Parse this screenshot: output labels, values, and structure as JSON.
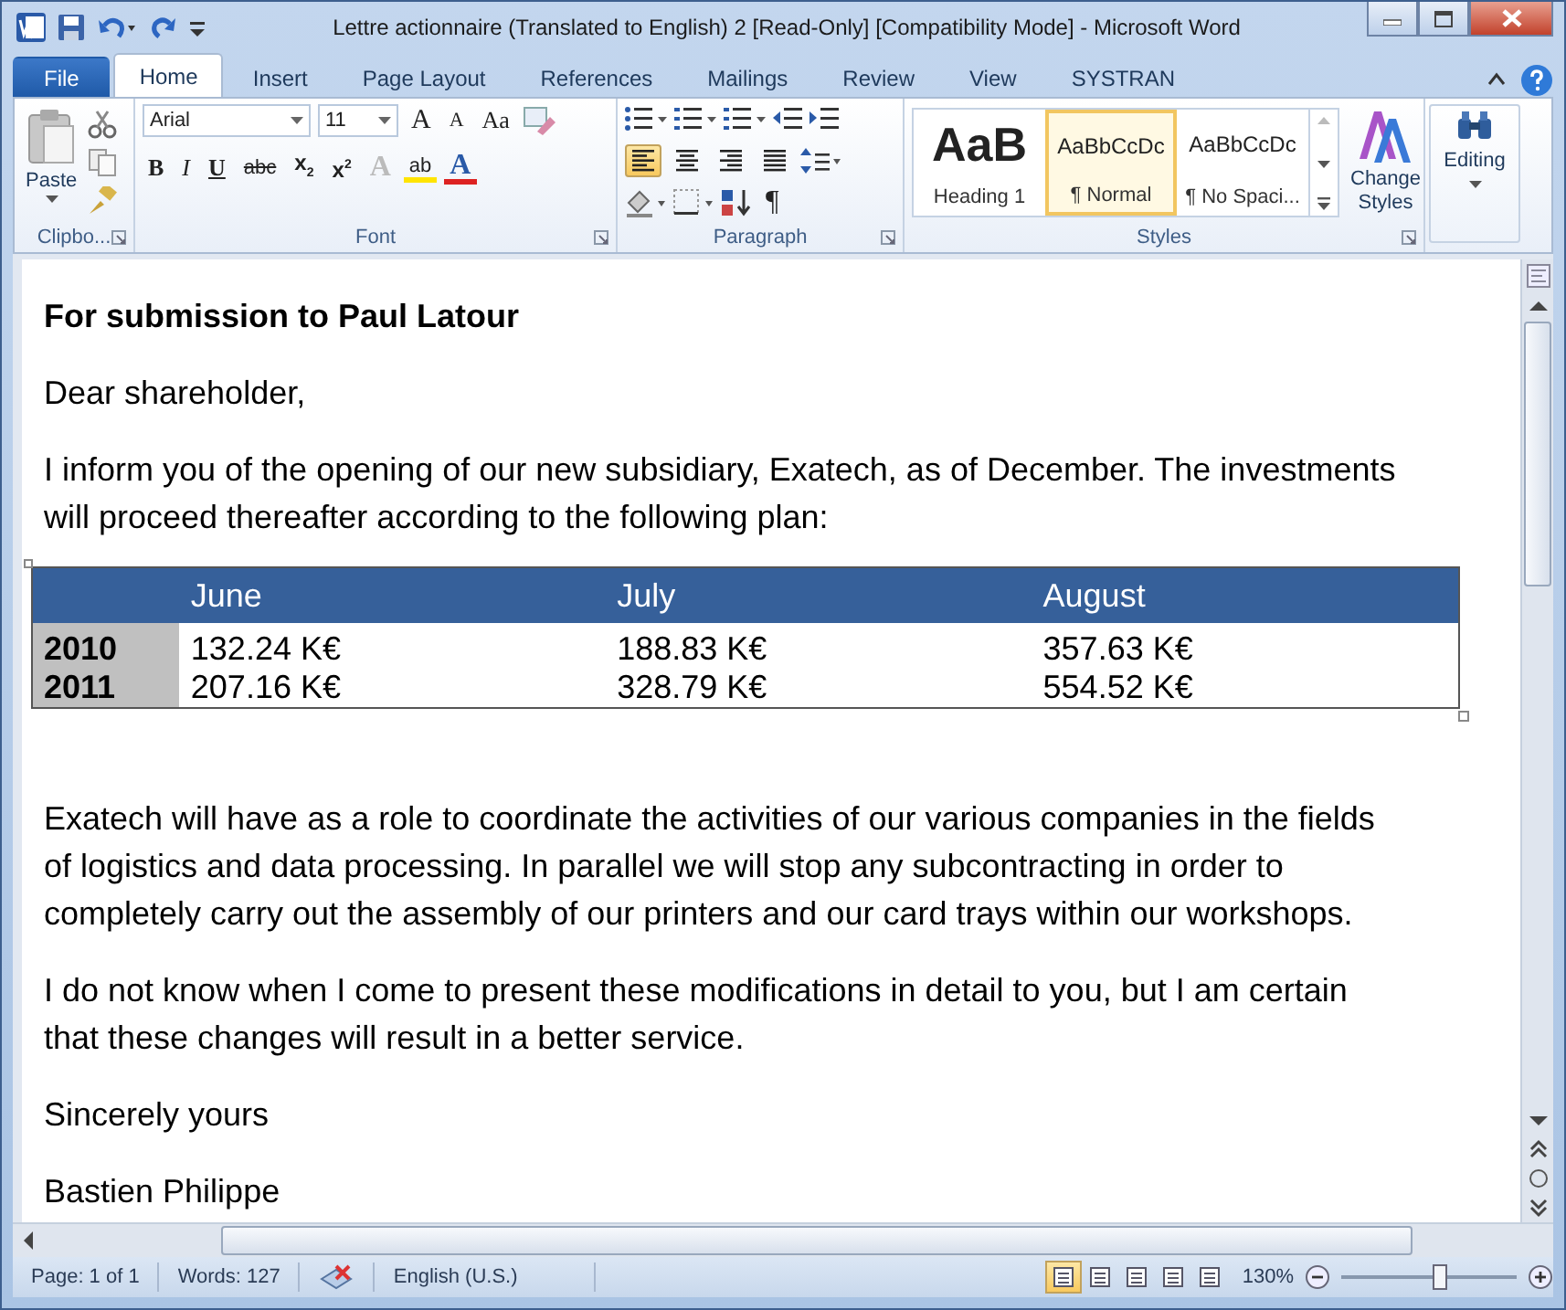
{
  "window": {
    "title": "Lettre actionnaire (Translated to English) 2 [Read-Only] [Compatibility Mode]  -  Microsoft Word"
  },
  "tabs": [
    {
      "label": "File",
      "kind": "file",
      "selected": false
    },
    {
      "label": "Home",
      "kind": "tab",
      "selected": true
    },
    {
      "label": "Insert",
      "kind": "tab",
      "selected": false
    },
    {
      "label": "Page Layout",
      "kind": "tab",
      "selected": false
    },
    {
      "label": "References",
      "kind": "tab",
      "selected": false
    },
    {
      "label": "Mailings",
      "kind": "tab",
      "selected": false
    },
    {
      "label": "Review",
      "kind": "tab",
      "selected": false
    },
    {
      "label": "View",
      "kind": "tab",
      "selected": false
    },
    {
      "label": "SYSTRAN",
      "kind": "tab",
      "selected": false
    }
  ],
  "ribbon": {
    "clipboard": {
      "paste": "Paste",
      "label": "Clipbo..."
    },
    "font": {
      "name": "Arial",
      "size": "11",
      "label": "Font",
      "row1": [
        {
          "kind": "grow",
          "glyph": "A"
        },
        {
          "kind": "shrink",
          "glyph": "A"
        },
        {
          "kind": "case",
          "glyph": "Aa"
        }
      ],
      "row2": [
        {
          "kind": "bold",
          "glyph": "B"
        },
        {
          "kind": "italic",
          "glyph": "I"
        },
        {
          "kind": "underline",
          "glyph": "U"
        },
        {
          "kind": "strike",
          "glyph": "abc"
        },
        {
          "kind": "sub",
          "glyph": "x$_{2}$"
        },
        {
          "kind": "sup",
          "glyph": "x$^{2}$"
        },
        {
          "kind": "effects",
          "glyph": "A"
        },
        {
          "kind": "highlight",
          "glyph": "ab"
        },
        {
          "kind": "color",
          "glyph": "A"
        }
      ]
    },
    "paragraph": {
      "label": "Paragraph",
      "show_marks": "¶",
      "align": [
        {
          "selected": true
        },
        {
          "selected": false
        },
        {
          "selected": false
        },
        {
          "selected": false
        }
      ]
    },
    "styles": {
      "label": "Styles",
      "items": [
        {
          "preview": "AaB",
          "name": "Heading 1",
          "kind": "heading",
          "selected": false
        },
        {
          "preview": "AaBbCcDc",
          "name": "¶ Normal",
          "kind": "normal",
          "selected": true
        },
        {
          "preview": "AaBbCcDc",
          "name": "¶ No Spaci...",
          "kind": "normal",
          "selected": false
        }
      ],
      "change": "Change Styles"
    },
    "editing": "Editing"
  },
  "document": {
    "blocks": [
      {
        "kind": "heading",
        "lines": [
          "For submission to Paul Latour"
        ]
      },
      {
        "kind": "paragraph",
        "lines": [
          "Dear shareholder,"
        ]
      },
      {
        "kind": "paragraph",
        "lines": [
          "I inform you of the opening of our new subsidiary, Exatech, as of December. The investments",
          "will proceed thereafter according to the following plan:"
        ]
      },
      {
        "kind": "table",
        "columns": [
          "June",
          "July",
          "August"
        ],
        "rows": [
          {
            "label": "2010",
            "cells": [
              "132.24 K€",
              "188.83 K€",
              "357.63 K€"
            ]
          },
          {
            "label": "2011",
            "cells": [
              "207.16 K€",
              "328.79 K€",
              "554.52 K€"
            ]
          }
        ]
      },
      {
        "kind": "paragraph",
        "lines": [
          "Exatech will have as a role to coordinate the activities of our various companies in the fields",
          "of logistics and data processing. In parallel we will stop any subcontracting in order to",
          "completely carry out the assembly of our printers and our card trays within our workshops."
        ]
      },
      {
        "kind": "paragraph",
        "lines": [
          "I do not know when I come to present these modifications in detail to you, but I am certain",
          "that these changes will result in a better service."
        ]
      },
      {
        "kind": "paragraph",
        "lines": [
          "Sincerely yours"
        ]
      },
      {
        "kind": "paragraph",
        "lines": [
          "Bastien Philippe"
        ]
      }
    ]
  },
  "status_bar": {
    "page": "Page: 1 of 1",
    "words": "Words: 127",
    "language": "English (U.S.)",
    "views": [
      {
        "selected": true
      },
      {
        "selected": false
      },
      {
        "selected": false
      },
      {
        "selected": false
      },
      {
        "selected": false
      }
    ],
    "zoom": "130%",
    "zoom_slider": {
      "level": 0.55
    }
  }
}
